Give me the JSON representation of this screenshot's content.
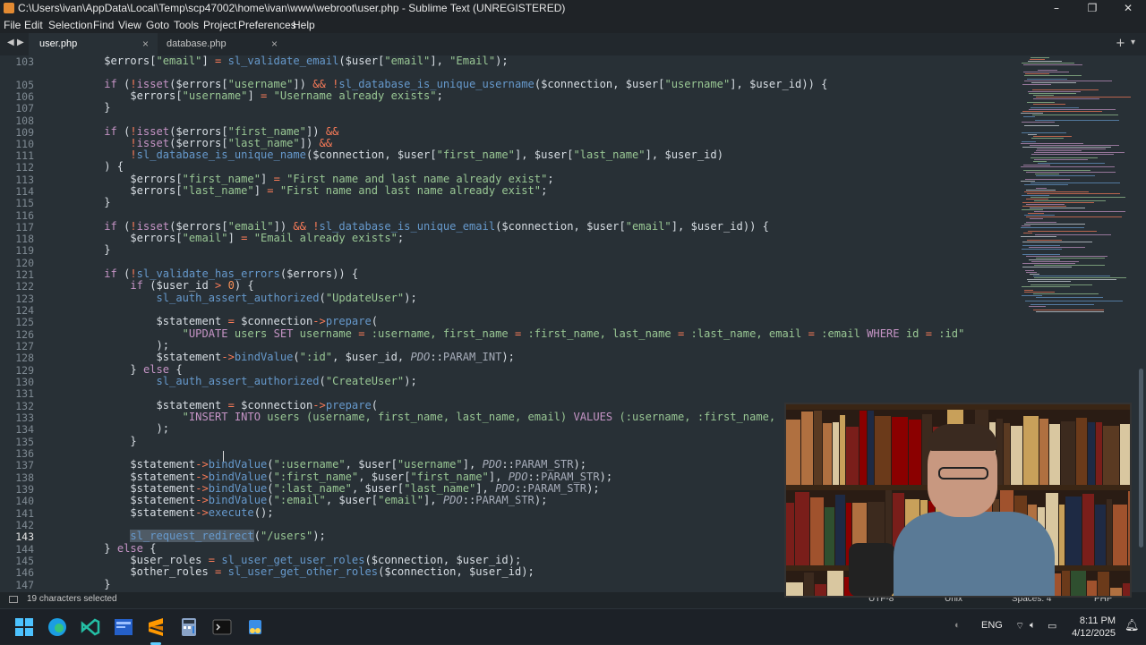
{
  "window": {
    "title": "C:\\Users\\ivan\\AppData\\Local\\Temp\\scp47002\\home\\ivan\\www\\webroot\\user.php - Sublime Text (UNREGISTERED)",
    "minimize": "–",
    "maximize": "❐",
    "close": "✕"
  },
  "menu": [
    "File",
    "Edit",
    "Selection",
    "Find",
    "View",
    "Goto",
    "Tools",
    "Project",
    "Preferences",
    "Help"
  ],
  "tabs": [
    {
      "label": "user.php",
      "active": true,
      "close": "×"
    },
    {
      "label": "database.php",
      "active": false,
      "close": "×"
    }
  ],
  "tabbar": {
    "nav_left": "◀",
    "nav_right": "▶",
    "new_tab": "+",
    "tab_menu": "▾"
  },
  "editor": {
    "current_line": 143,
    "line_numbers": [
      "103",
      "105",
      "106",
      "107",
      "108",
      "109",
      "110",
      "111",
      "112",
      "113",
      "114",
      "115",
      "116",
      "117",
      "118",
      "119",
      "120",
      "121",
      "122",
      "123",
      "124",
      "125",
      "126",
      "127",
      "128",
      "129",
      "130",
      "131",
      "132",
      "133",
      "134",
      "135",
      "136",
      "137",
      "138",
      "139",
      "140",
      "141",
      "142",
      "143",
      "144",
      "145",
      "146",
      "147"
    ]
  },
  "status": {
    "selection": "19 characters selected",
    "encoding": "UTF-8",
    "line_endings": "Unix",
    "indent": "Spaces: 4",
    "syntax": "PHP"
  },
  "taskbar": {
    "language": "ENG",
    "time": "8:11 PM",
    "date": "4/12/2025",
    "apps": [
      "windows-start",
      "edge",
      "vscode-insiders",
      "visual-studio",
      "sublime-text",
      "calculator",
      "terminal",
      "snipping-tool"
    ]
  },
  "colors": {
    "editor_bg": "#283036",
    "keyword": "#c594c5",
    "function": "#6699cc",
    "string": "#99c794",
    "operator": "#f97b58",
    "taskbar_accent": "#60cdff"
  }
}
